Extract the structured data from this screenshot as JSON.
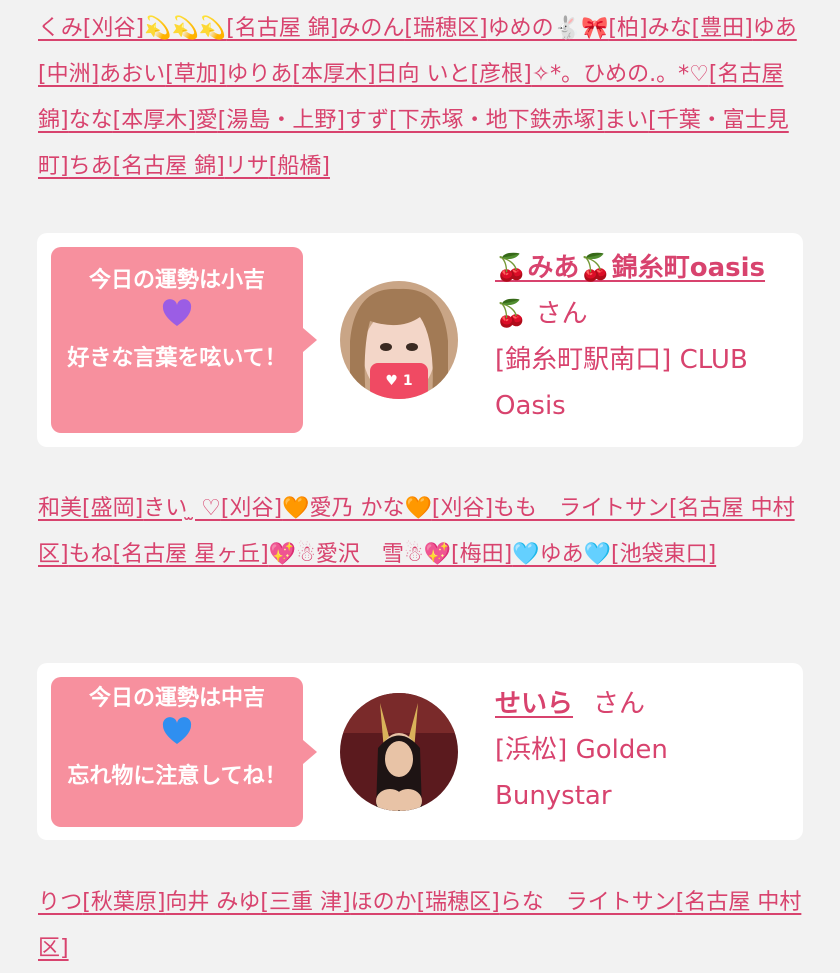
{
  "colors": {
    "accent": "#d8436e",
    "bubble": "#f7909e",
    "background": "#f2f2f2",
    "purple_heart": "#9b5de5",
    "blue_heart": "#2f8ff0"
  },
  "links_top": [
    "くみ[刈谷]💫💫💫",
    "[名古屋 錦]",
    "みのん",
    "[瑞穂区]",
    "ゆめの🐇🎀",
    "[柏]",
    "みな",
    "[豊田]",
    "ゆあ",
    "[中洲]",
    "あおい",
    "[草加]",
    "ゆりあ",
    "[本厚木]",
    "日向 いと",
    "[彦根]",
    "✧*。ひめの.。*♡",
    "[名古屋 錦]",
    "なな",
    "[本厚木]",
    "愛",
    "[湯島・上野]",
    "すず",
    "[下赤塚・地下鉄赤塚]",
    "まい",
    "[千葉・富士見町]",
    "ちあ",
    "[名古屋 錦]",
    "リサ",
    "[船橋]"
  ],
  "card1": {
    "fortune_line": "今日の運勢は小吉",
    "heart_icon": "purple-heart",
    "message": "好きな言葉を呟いて！",
    "like_count": "1",
    "name": "🍒みあ🍒錦糸町oasis",
    "name_suffix": "🍒 さん",
    "area": "[錦糸町駅南口]",
    "shop": "CLUB Oasis"
  },
  "links_middle": [
    "和美",
    "[盛岡]",
    "きい ̫ ♡",
    "[刈谷]",
    "🧡愛乃 かな🧡",
    "[刈谷]",
    "もも　ライトサン",
    "[名古屋 中村区]",
    "もね",
    "[名古屋 星ヶ丘]",
    "💖☃愛沢　雪☃💖",
    "[梅田]",
    "🩵ゆあ🩵",
    "[池袋東口]"
  ],
  "card2": {
    "fortune_line": "今日の運勢は中吉",
    "heart_icon": "blue-heart",
    "message": "忘れ物に注意してね！",
    "name": "せいら",
    "name_suffix": "さん",
    "area": "[浜松]",
    "shop": "Golden Bunystar"
  },
  "links_bottom": [
    "りつ",
    "[秋葉原]",
    "向井 みゆ",
    "[三重 津]",
    "ほのか",
    "[瑞穂区]",
    "らな　ライトサン",
    "[名古屋 中村区]"
  ]
}
